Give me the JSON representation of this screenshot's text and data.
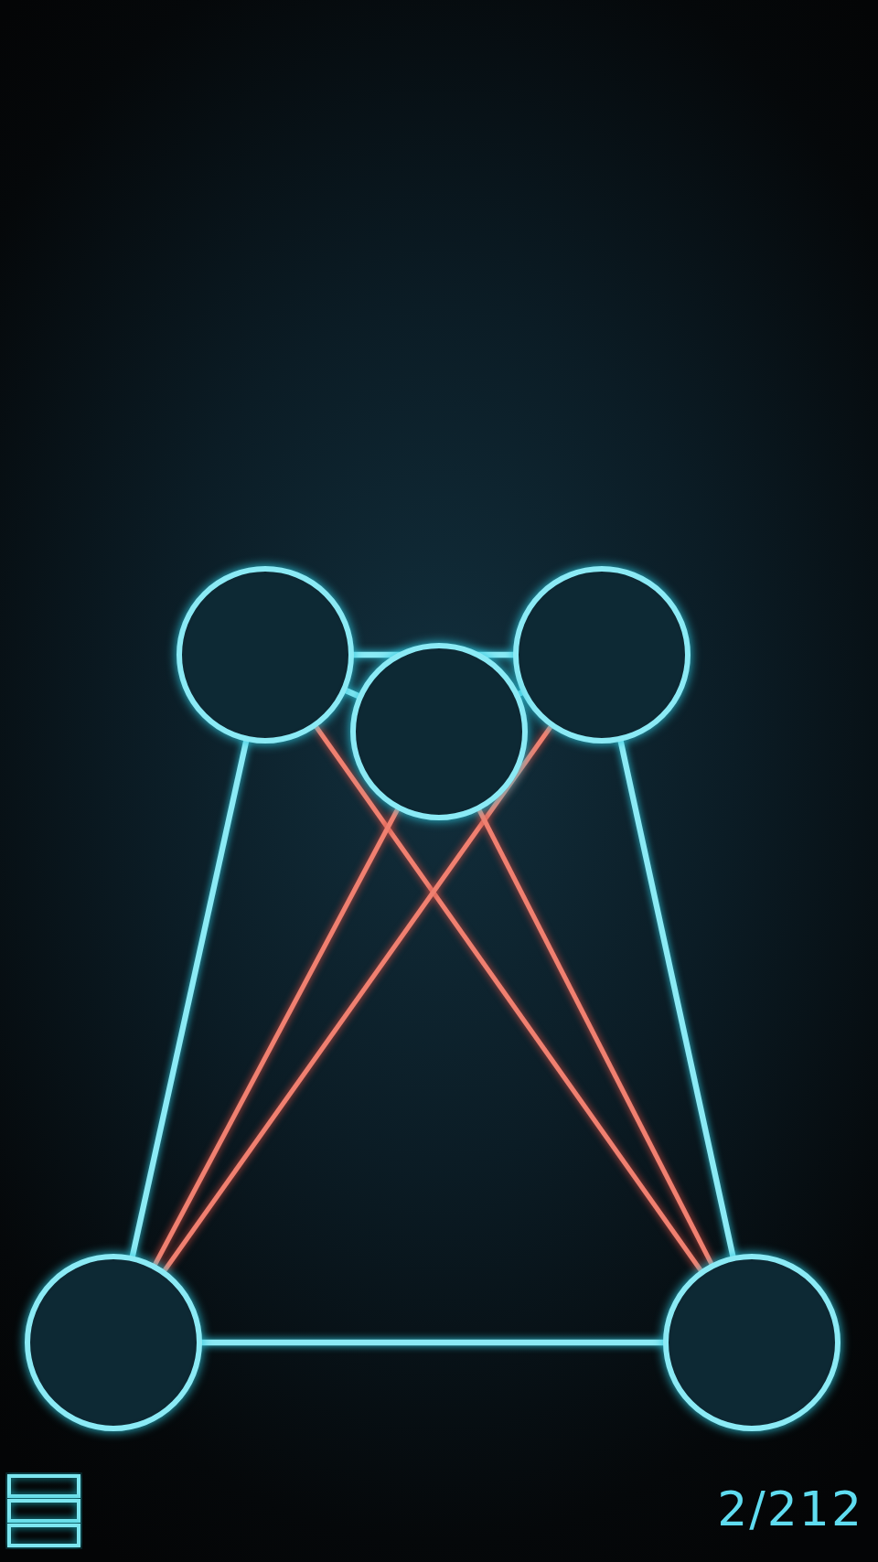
{
  "puzzle": {
    "edges": [
      {
        "kind": "edge",
        "crossing": false
      },
      {
        "kind": "edge",
        "crossing": false
      },
      {
        "kind": "edge",
        "crossing": false
      },
      {
        "kind": "edge",
        "crossing": false
      },
      {
        "kind": "edge",
        "crossing": false
      },
      {
        "kind": "edge",
        "crossing": false
      },
      {
        "kind": "edge",
        "crossing": true
      },
      {
        "kind": "edge",
        "crossing": true
      },
      {
        "kind": "edge",
        "crossing": true
      },
      {
        "kind": "edge",
        "crossing": true
      }
    ]
  },
  "level_counter": "2/212"
}
